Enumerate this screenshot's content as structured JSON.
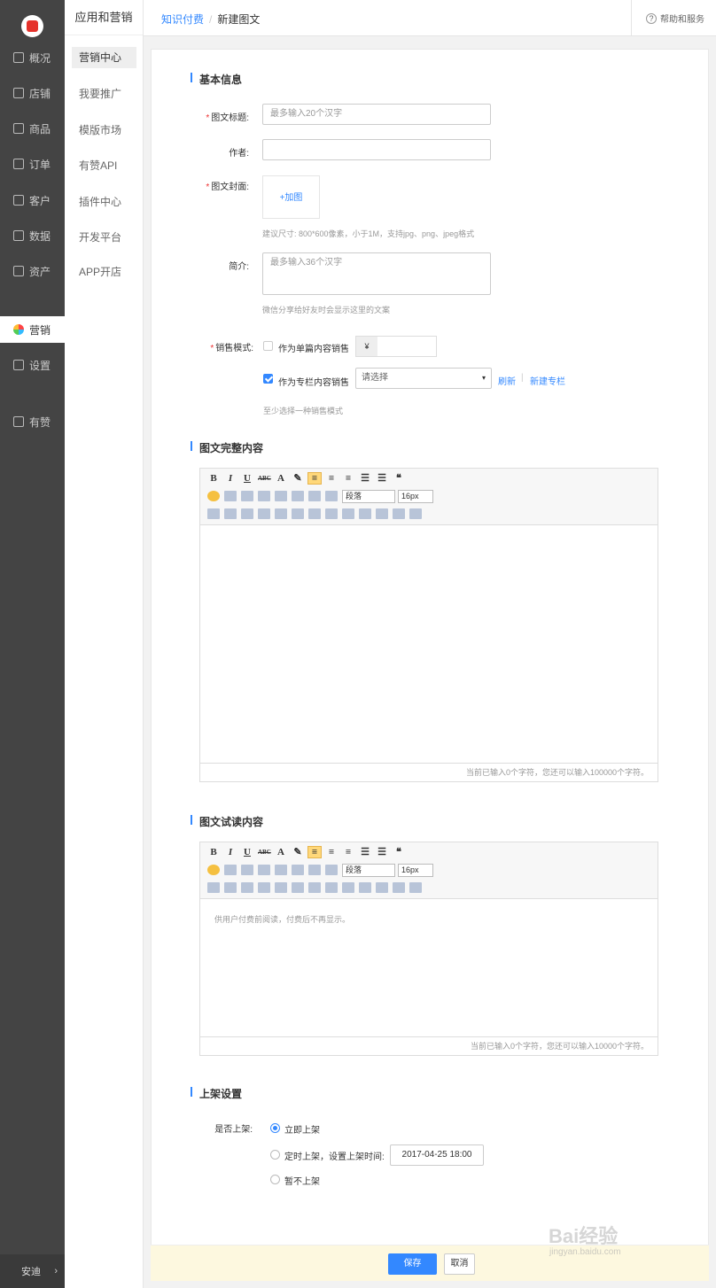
{
  "sidebar": {
    "items": [
      {
        "label": "概况",
        "icon": "monitor-icon"
      },
      {
        "label": "店铺",
        "icon": "store-icon"
      },
      {
        "label": "商品",
        "icon": "tag-icon"
      },
      {
        "label": "订单",
        "icon": "order-icon"
      },
      {
        "label": "客户",
        "icon": "user-icon"
      },
      {
        "label": "数据",
        "icon": "bar-chart-icon"
      },
      {
        "label": "资产",
        "icon": "yen-icon"
      },
      {
        "label": "营销",
        "icon": "marketing-icon"
      },
      {
        "label": "设置",
        "icon": "gear-icon"
      },
      {
        "label": "有赞",
        "icon": "thumbs-up-icon"
      }
    ],
    "user": "安迪",
    "user_arrow": "›"
  },
  "subnav": {
    "title": "应用和营销",
    "items": [
      "营销中心",
      "我要推广",
      "模版市场",
      "有赞API",
      "插件中心",
      "开发平台",
      "APP开店"
    ]
  },
  "breadcrumb": {
    "parent": "知识付费",
    "separator": "/",
    "current": "新建图文"
  },
  "help": {
    "icon_text": "?",
    "label": "帮助和服务"
  },
  "basic": {
    "section_title": "基本信息",
    "req_mark": "*",
    "title_label": "图文标题:",
    "title_placeholder": "最多输入20个汉字",
    "author_label": "作者:",
    "author_value": "",
    "cover_label": "图文封面:",
    "cover_add": "+加图",
    "cover_hint": "建议尺寸: 800*600像素，小于1M，支持jpg、png、jpeg格式",
    "intro_label": "简介:",
    "intro_placeholder": "最多输入36个汉字",
    "intro_hint": "微信分享给好友时会显示这里的文案",
    "sale_label": "销售模式:",
    "single_label": "作为单篇内容销售",
    "currency": "¥",
    "price_value": "",
    "column_label": "作为专栏内容销售",
    "column_select": "请选择",
    "select_caret": "▾",
    "refresh": "刷新",
    "link_sep": "|",
    "new_column": "新建专栏",
    "sale_hint": "至少选择一种销售模式"
  },
  "toolbar": {
    "row1": [
      "B",
      "I",
      "U",
      "ABC",
      "A",
      "✎",
      "≡",
      "≡",
      "≡",
      "☰",
      "☰",
      "❝"
    ],
    "paragraph": "段落",
    "font_size": "16px"
  },
  "full_content": {
    "section_title": "图文完整内容",
    "counter": "当前已输入0个字符，您还可以输入100000个字符。"
  },
  "trial_content": {
    "section_title": "图文试读内容",
    "placeholder": "供用户付费前阅读，付费后不再显示。",
    "counter": "当前已输入0个字符，您还可以输入10000个字符。"
  },
  "publish": {
    "section_title": "上架设置",
    "label": "是否上架:",
    "options": [
      "立即上架",
      "定时上架，设置上架时间:",
      "暂不上架"
    ],
    "selected": 0,
    "datetime": "2017-04-25 18:00"
  },
  "footer": {
    "save": "保存",
    "cancel": "取消"
  },
  "watermark": {
    "text": "Bai经验",
    "sub": "jingyan.baidu.com"
  },
  "colors": {
    "accent": "#3388ff",
    "sidebar": "#444444",
    "footer_bg": "#fdf8df"
  }
}
